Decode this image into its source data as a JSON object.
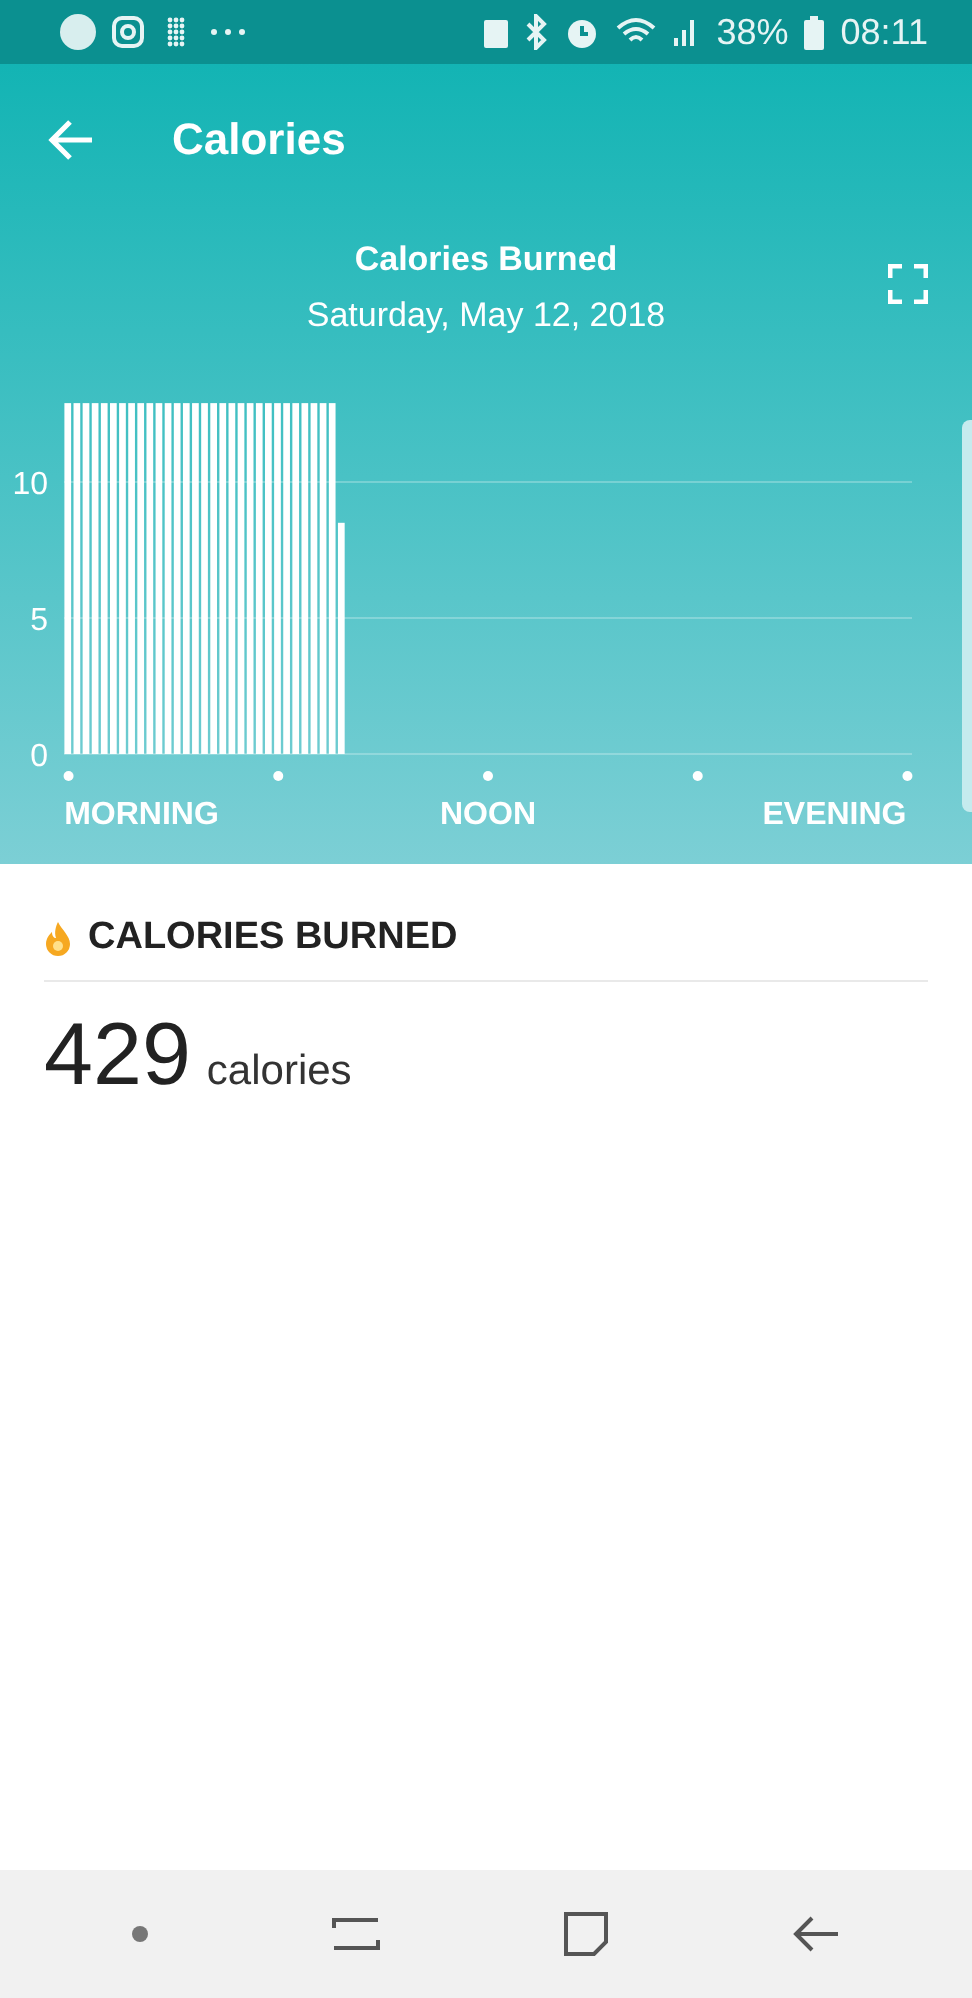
{
  "status_bar": {
    "battery": "38%",
    "time": "08:11"
  },
  "app_bar": {
    "title": "Calories"
  },
  "chart_header": {
    "title": "Calories Burned",
    "date": "Saturday, May 12, 2018"
  },
  "chart_data": {
    "type": "bar",
    "categories": [
      null,
      null,
      null,
      null,
      null,
      null,
      null,
      null,
      "MORNING",
      null,
      null,
      null,
      null,
      null,
      null,
      null,
      null,
      null,
      null,
      null,
      null,
      null,
      null,
      null,
      null,
      null,
      null,
      null,
      null,
      null,
      null,
      null,
      null,
      null,
      null,
      null,
      null,
      null,
      null,
      null,
      null,
      null,
      null,
      null,
      null,
      null,
      "NOON",
      null,
      null,
      null,
      null,
      null,
      null,
      null,
      null,
      null,
      null,
      null,
      null,
      null,
      null,
      null,
      null,
      null,
      null,
      null,
      null,
      null,
      null,
      null,
      null,
      null,
      null,
      null,
      null,
      null,
      null,
      null,
      null,
      null,
      null,
      null,
      null,
      null,
      "EVENING",
      null,
      null,
      null,
      null,
      null,
      null,
      null,
      null
    ],
    "values": [
      12.9,
      12.9,
      12.9,
      12.9,
      12.9,
      12.9,
      12.9,
      12.9,
      12.9,
      12.9,
      12.9,
      12.9,
      12.9,
      12.9,
      12.9,
      12.9,
      12.9,
      12.9,
      12.9,
      12.9,
      12.9,
      12.9,
      12.9,
      12.9,
      12.9,
      12.9,
      12.9,
      12.9,
      12.9,
      12.9,
      8.5,
      null,
      null,
      null,
      null,
      null,
      null,
      null,
      null,
      null,
      null,
      null,
      null,
      null,
      null,
      null,
      null,
      null,
      null,
      null,
      null,
      null,
      null,
      null,
      null,
      null,
      null,
      null,
      null,
      null,
      null,
      null,
      null,
      null,
      null,
      null,
      null,
      null,
      null,
      null,
      null,
      null,
      null,
      null,
      null,
      null,
      null,
      null,
      null,
      null,
      null,
      null,
      null,
      null,
      null,
      null,
      null,
      null,
      null,
      null,
      null,
      null,
      null
    ],
    "ylim": [
      0,
      13
    ],
    "yticks": [
      0,
      5,
      10
    ]
  },
  "summary": {
    "heading": "CALORIES BURNED",
    "value": "429",
    "unit": "calories"
  }
}
